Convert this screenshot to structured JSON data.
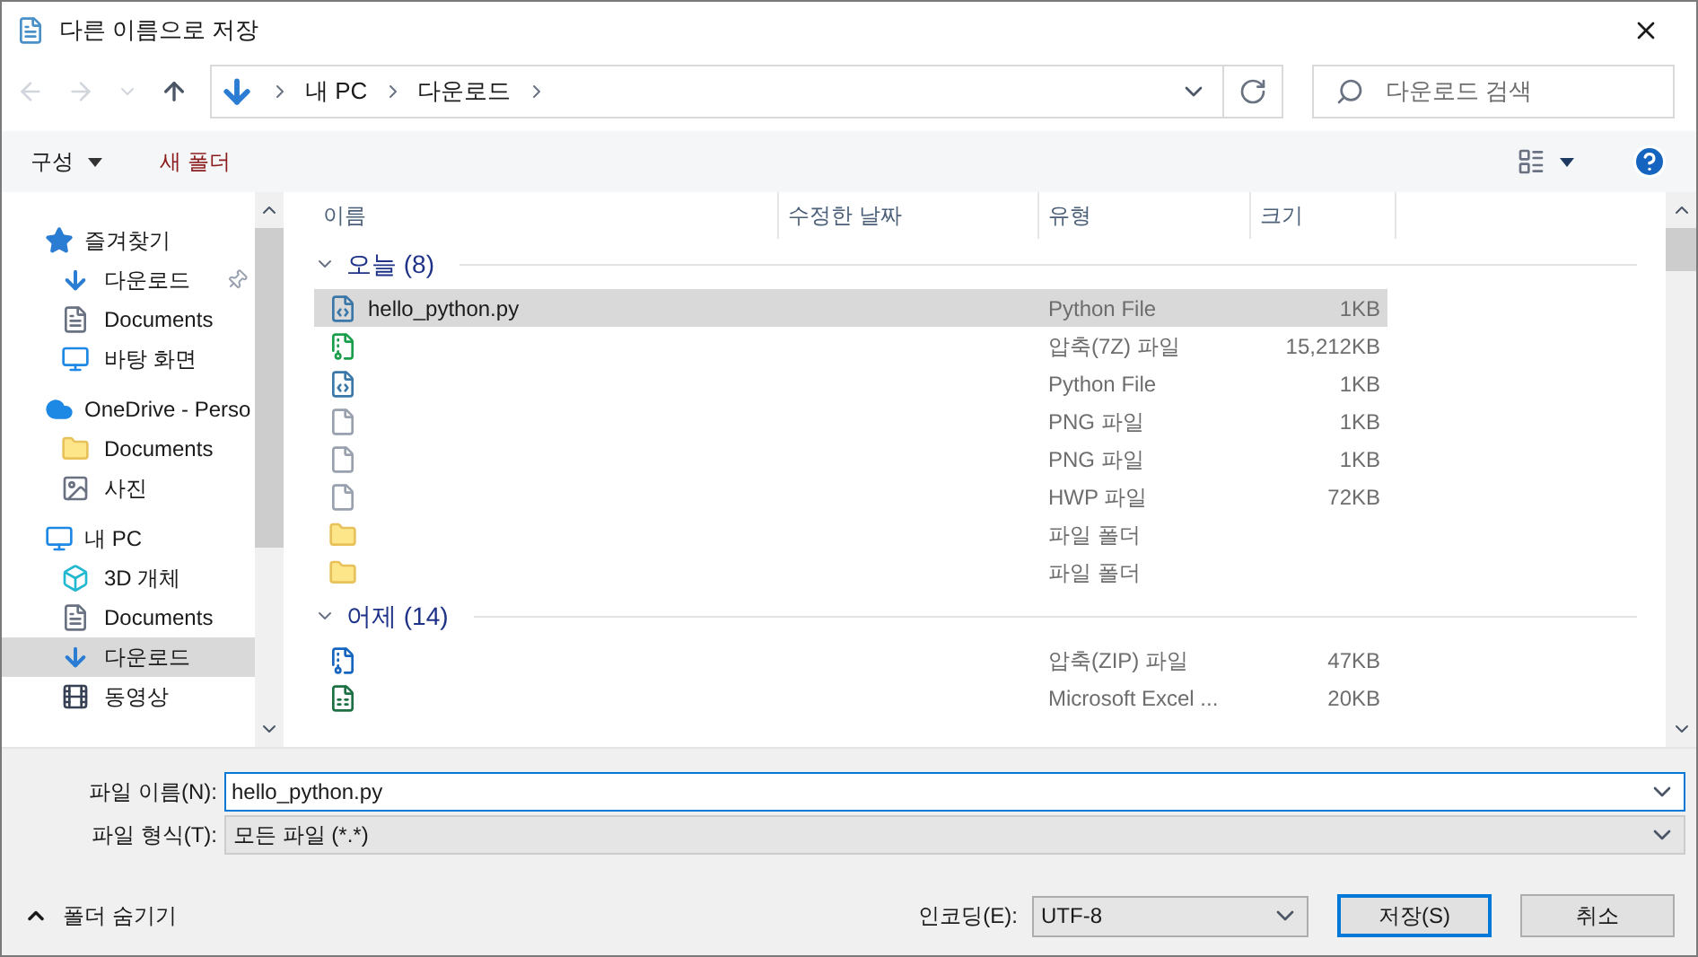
{
  "window": {
    "title": "다른 이름으로 저장"
  },
  "address": {
    "path": [
      "내 PC",
      "다운로드"
    ]
  },
  "search": {
    "placeholder": "다운로드 검색"
  },
  "toolbar": {
    "organize": "구성",
    "new_folder": "새 폴더"
  },
  "sidebar": {
    "groups": [
      {
        "label": "즐겨찾기",
        "children": [
          {
            "label": "다운로드",
            "pinned": true,
            "selected": false
          },
          {
            "label": "Documents",
            "pinned": false,
            "selected": false
          },
          {
            "label": "바탕 화면",
            "pinned": false,
            "selected": false
          }
        ]
      },
      {
        "label": "OneDrive - Perso",
        "children": [
          {
            "label": "Documents",
            "pinned": false,
            "selected": false
          },
          {
            "label": "사진",
            "pinned": false,
            "selected": false
          }
        ]
      },
      {
        "label": "내 PC",
        "children": [
          {
            "label": "3D 개체",
            "pinned": false,
            "selected": false
          },
          {
            "label": "Documents",
            "pinned": false,
            "selected": false
          },
          {
            "label": "다운로드",
            "pinned": false,
            "selected": true
          },
          {
            "label": "동영상",
            "pinned": false,
            "selected": false
          }
        ]
      }
    ]
  },
  "table": {
    "columns": [
      "이름",
      "수정한 날짜",
      "유형",
      "크기"
    ],
    "groups": [
      {
        "label": "오늘 (8)",
        "expanded": true,
        "rows": [
          {
            "name": "hello_python.py",
            "type": "Python File",
            "size": "1KB",
            "selected": true
          },
          {
            "type": "압축(7Z) 파일",
            "size": "15,212KB",
            "selected": false
          },
          {
            "type": "Python File",
            "size": "1KB",
            "selected": false
          },
          {
            "type": "PNG 파일",
            "size": "1KB",
            "selected": false
          },
          {
            "type": "PNG 파일",
            "size": "1KB",
            "selected": false
          },
          {
            "type": "HWP 파일",
            "size": "72KB",
            "selected": false
          },
          {
            "type": "파일 폴더",
            "selected": false
          },
          {
            "type": "파일 폴더",
            "selected": false
          }
        ]
      },
      {
        "label": "어제 (14)",
        "expanded": true,
        "rows": [
          {
            "type": "압축(ZIP) 파일",
            "size": "47KB",
            "selected": false
          },
          {
            "type": "Microsoft Excel ...",
            "size": "20KB",
            "selected": false
          }
        ]
      }
    ]
  },
  "form": {
    "filename_label": "파일 이름(N):",
    "filename": "hello_python.py",
    "filetype_label": "파일 형식(T):",
    "filetype": "모든 파일 (*.*)"
  },
  "footer": {
    "hide_folders": "폴더 숨기기",
    "encoding_label": "인코딩(E):",
    "encoding": "UTF-8",
    "save": "저장(S)",
    "cancel": "취소"
  }
}
